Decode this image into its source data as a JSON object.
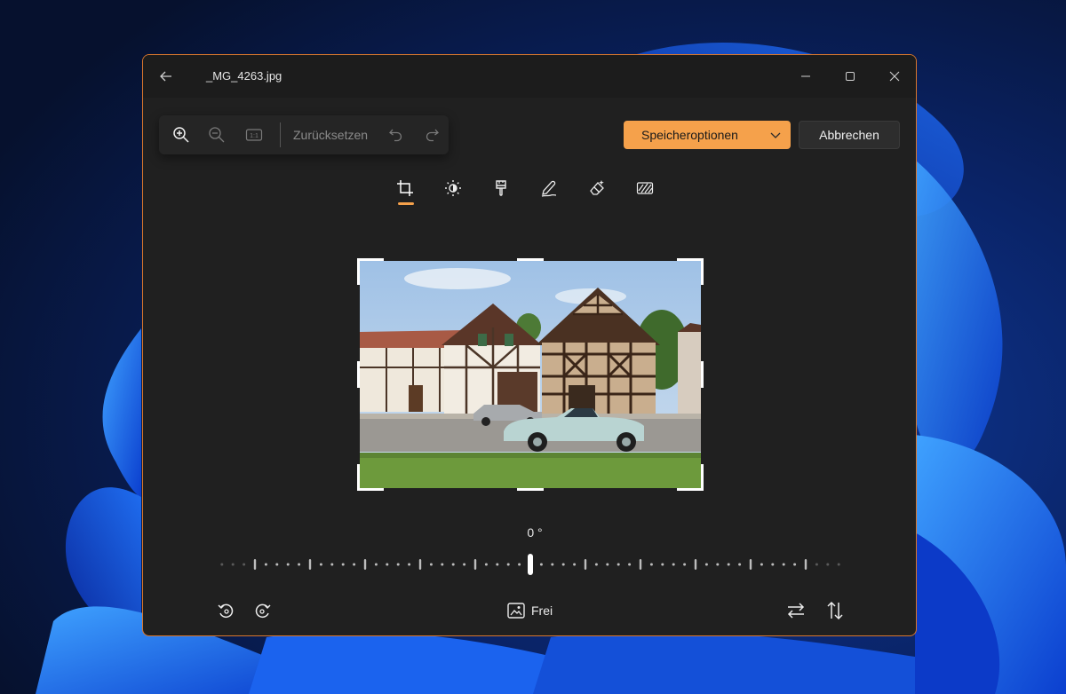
{
  "window": {
    "file_name": "_MG_4263.jpg",
    "back_icon": "arrow-left-icon",
    "controls": [
      "minimize-icon",
      "maximize-icon",
      "close-icon"
    ]
  },
  "toolbar": {
    "zoom_in_icon": "zoom-in-icon",
    "zoom_out_icon": "zoom-out-icon",
    "actual_size_label": "1:1",
    "reset_label": "Zurücksetzen",
    "undo_icon": "undo-icon",
    "redo_icon": "redo-icon"
  },
  "actions": {
    "save_label": "Speicheroptionen",
    "cancel_label": "Abbrechen"
  },
  "tabs": [
    {
      "name": "crop",
      "icon": "crop-icon",
      "active": true
    },
    {
      "name": "adjust",
      "icon": "brightness-icon",
      "active": false
    },
    {
      "name": "filter",
      "icon": "filter-brush-icon",
      "active": false
    },
    {
      "name": "markup",
      "icon": "pen-icon",
      "active": false
    },
    {
      "name": "erase",
      "icon": "eraser-icon",
      "active": false
    },
    {
      "name": "background",
      "icon": "background-blur-icon",
      "active": false
    }
  ],
  "straighten": {
    "angle": "0 °",
    "value": 0
  },
  "bottom": {
    "rotate_left_icon": "rotate-left-icon",
    "rotate_right_icon": "rotate-right-icon",
    "aspect_label": "Frei",
    "flip_horizontal_icon": "flip-horizontal-icon",
    "flip_vertical_icon": "flip-vertical-icon"
  },
  "colors": {
    "accent": "#f5a14b",
    "window_border": "#d9772c",
    "background": "#202020"
  }
}
